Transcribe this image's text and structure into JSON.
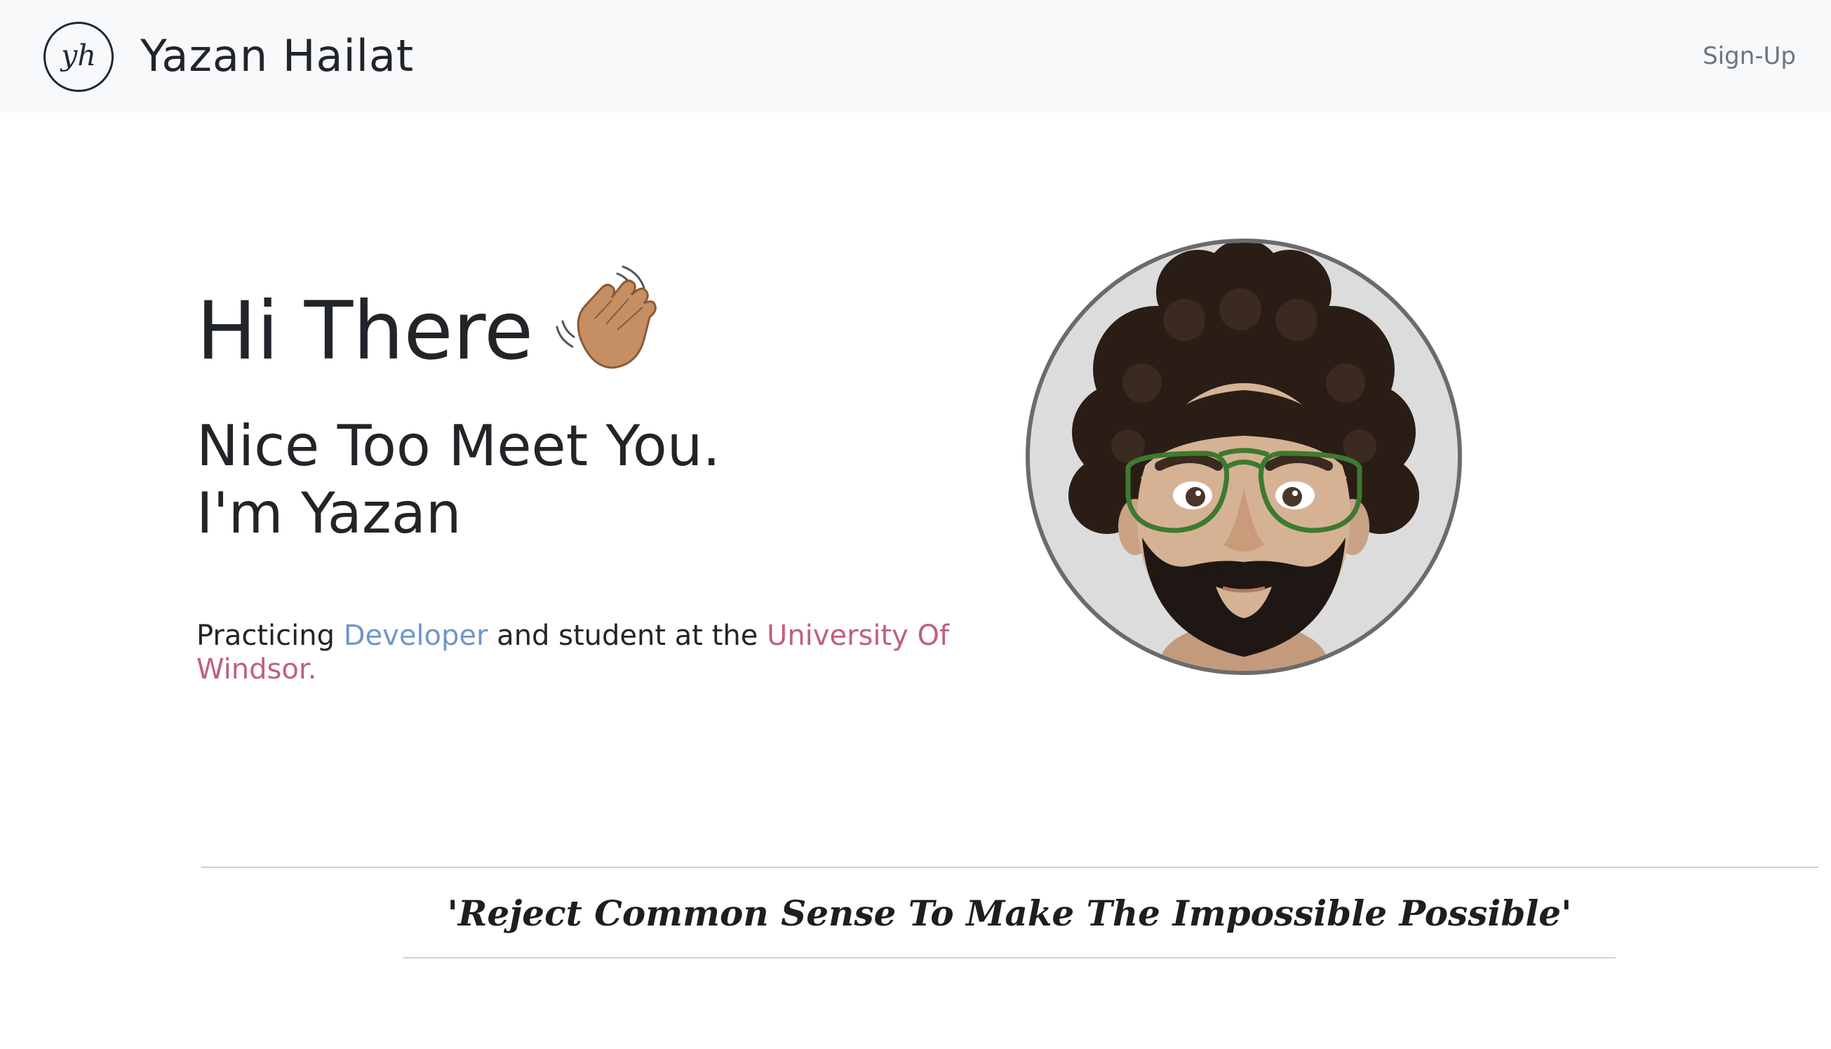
{
  "navbar": {
    "logo_text": "yh",
    "brand_name": "Yazan Hailat",
    "signup_label": "Sign-Up"
  },
  "hero": {
    "title": "Hi There",
    "wave_icon": "waving-hand-icon",
    "subtitle_line1": "Nice Too Meet You.",
    "subtitle_line2": "I'm Yazan",
    "desc_prefix": "Practicing ",
    "desc_role": "Developer",
    "desc_middle": " and student at the ",
    "desc_school": "University Of Windsor.",
    "avatar_icon": "memoji-avatar-icon"
  },
  "quote": {
    "text": "'Reject Common Sense To Make The Impossible Possible'"
  },
  "colors": {
    "navbar_bg": "#f8f9fa",
    "role_accent": "#6f97c9",
    "school_accent": "#c0607e",
    "text": "#212529",
    "muted": "#6c757d"
  }
}
